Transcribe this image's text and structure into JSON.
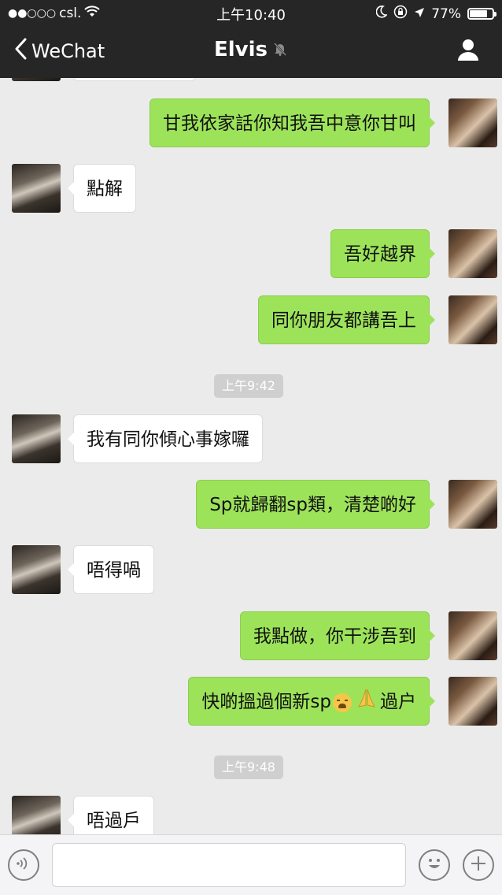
{
  "status_bar": {
    "carrier": "csl.",
    "signal": "●●○○○",
    "time": "上午10:40",
    "battery": "77%",
    "battery_level": 0.77
  },
  "nav": {
    "back_label": "WeChat",
    "title": "Elvis"
  },
  "messages": [
    {
      "side": "me",
      "text": "甘我依家話你知我吾中意你甘叫"
    },
    {
      "side": "them",
      "text": "點解"
    },
    {
      "side": "me",
      "text": "吾好越界"
    },
    {
      "side": "me",
      "text": "同你朋友都講吾上"
    },
    {
      "timestamp": "上午9:42"
    },
    {
      "side": "them",
      "text": "我有同你傾心事嫁囉"
    },
    {
      "side": "me",
      "text": "Sp就歸翻sp類，清楚啲好"
    },
    {
      "side": "them",
      "text": "唔得喎"
    },
    {
      "side": "me",
      "text": "我點做，你干涉吾到"
    },
    {
      "side": "me",
      "text_before": "快啲搵過個新sp",
      "emoji1": "weary-face-emoji",
      "emoji2": "folded-hands-emoji",
      "text_after": "過户"
    },
    {
      "timestamp": "上午9:48"
    },
    {
      "side": "them",
      "text": "唔過戶"
    }
  ],
  "input": {
    "placeholder": ""
  },
  "colors": {
    "topbar": "#262626",
    "chat_bg": "#ebebeb",
    "my_bubble": "#9de35a",
    "their_bubble": "#ffffff"
  }
}
